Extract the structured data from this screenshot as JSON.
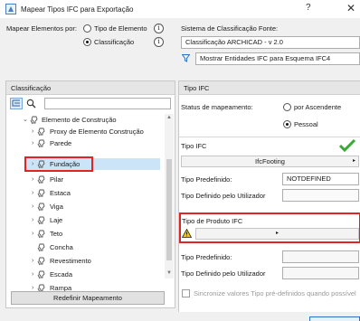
{
  "window": {
    "title": "Mapear Tipos IFC para Exportação",
    "help": "?",
    "close": "✕"
  },
  "mapping": {
    "label": "Mapear Elementos por:",
    "option_element_type": "Tipo de Elemento",
    "option_classification": "Classificação",
    "selected": "Classificação"
  },
  "source_system": {
    "label": "Sistema de Classificação Fonte:",
    "value": "Classificação ARCHICAD - v 2.0",
    "filter_value": "Mostrar Entidades IFC para Esquema IFC4"
  },
  "classification_panel": {
    "header": "Classificação",
    "search_placeholder": "",
    "items": [
      {
        "label": "Elemento de Construção",
        "level": 0,
        "expanded": true
      },
      {
        "label": "Proxy de Elemento Construção",
        "level": 1
      },
      {
        "label": "Parede",
        "level": 1
      },
      {
        "label": "Fundação",
        "level": 1,
        "selected": true
      },
      {
        "label": "Pilar",
        "level": 1
      },
      {
        "label": "Estaca",
        "level": 1
      },
      {
        "label": "Viga",
        "level": 1
      },
      {
        "label": "Laje",
        "level": 1
      },
      {
        "label": "Teto",
        "level": 1
      },
      {
        "label": "Concha",
        "level": 1
      },
      {
        "label": "Revestimento",
        "level": 1
      },
      {
        "label": "Escada",
        "level": 1
      },
      {
        "label": "Rampa",
        "level": 1
      }
    ],
    "reset_button": "Redefinir Mapeamento"
  },
  "ifc_type_panel": {
    "header": "Tipo IFC",
    "status_label": "Status de mapeamento:",
    "status_option_ancestor": "por Ascendente",
    "status_option_custom": "Pessoal",
    "status_selected": "Pessoal",
    "ifc_type_label": "Tipo IFC",
    "ifc_type_value": "IfcFooting",
    "predefined_label": "Tipo Predefinido:",
    "predefined_value": "NOTDEFINED",
    "user_defined_label": "Tipo Definido pelo Utilizador",
    "product_type_label": "Tipo de Produto IFC",
    "product_type_value": "",
    "predefined_label_2": "Tipo Predefinido:",
    "user_defined_label_2": "Tipo Definido pelo Utilizador",
    "sync_label": "Sincronize valores Tipo pré-definidos quando possível"
  },
  "colors": {
    "highlight_red": "#e02424",
    "selection_blue": "#cce4f7",
    "check_green": "#3aa935",
    "warning_yellow": "#f5c400"
  },
  "icons": {
    "app": "ifc-map-icon",
    "search": "search-icon",
    "tree_view": "tree-view-icon",
    "filter": "filter-icon",
    "warning": "warning-icon",
    "check": "check-icon",
    "classification": "classification-bulb-icon"
  }
}
